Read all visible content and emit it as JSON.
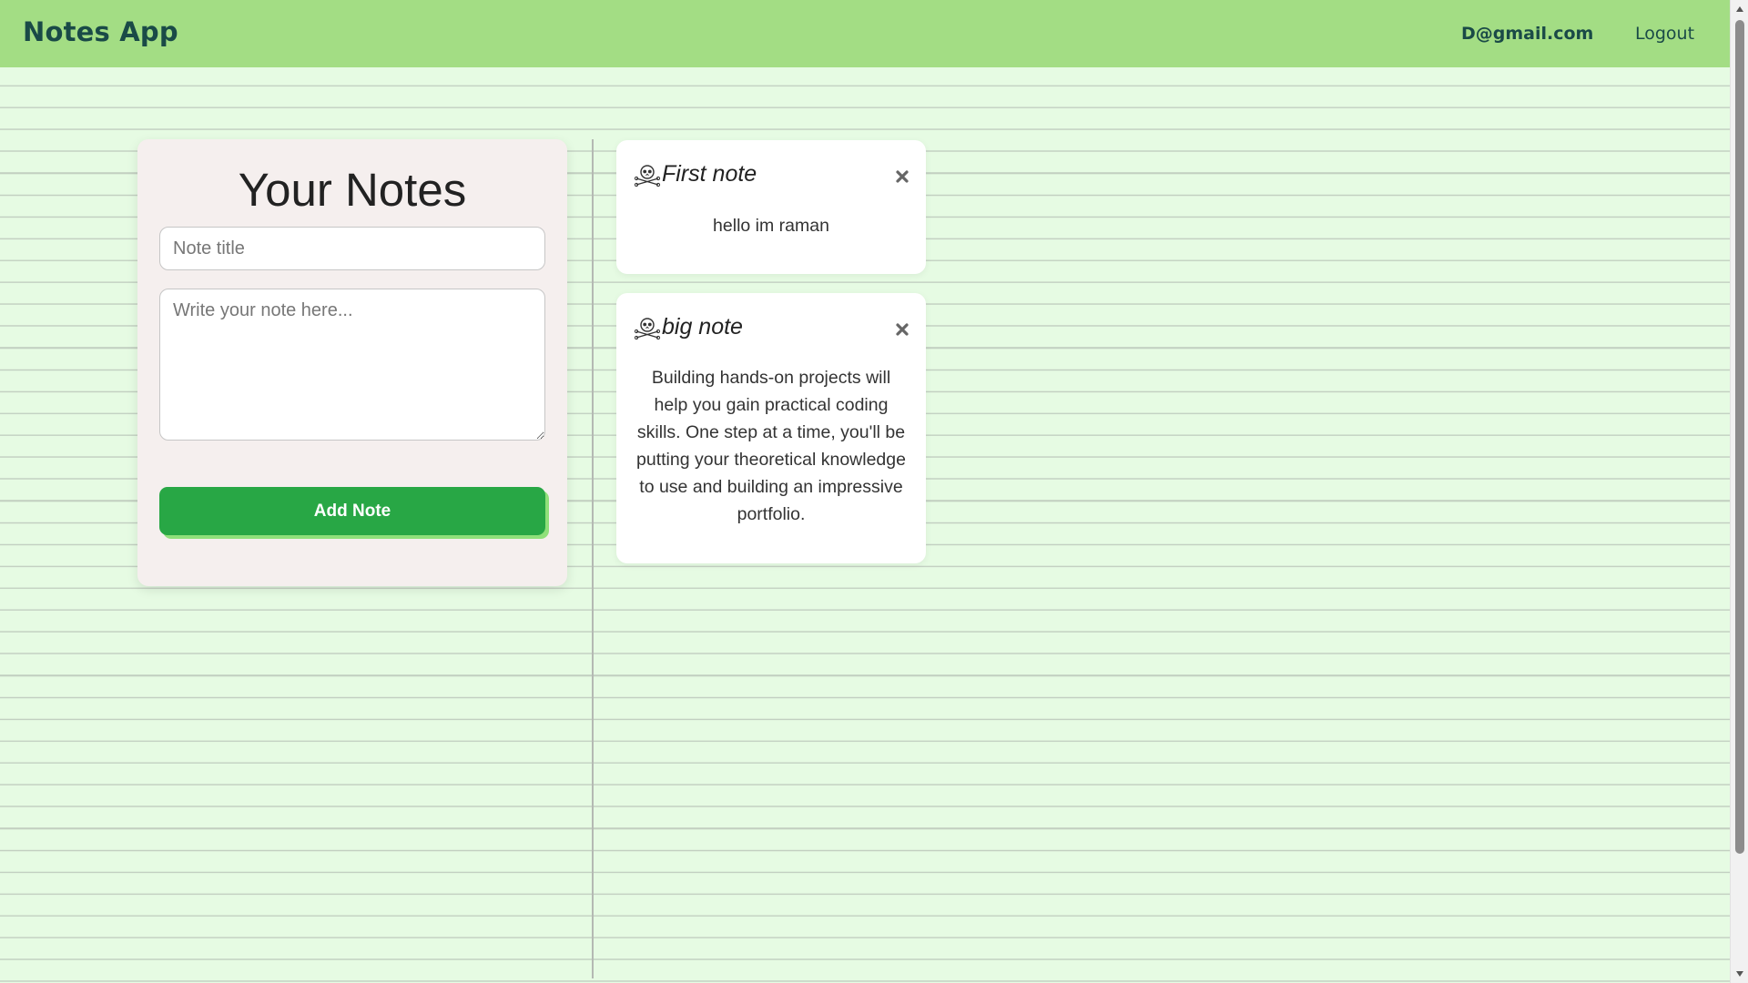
{
  "header": {
    "brand": "Notes App",
    "user_email": "D@gmail.com",
    "logout_label": "Logout",
    "background_color": "#a3dd84"
  },
  "form": {
    "title": "Your Notes",
    "title_placeholder": "Note title",
    "body_placeholder": "Write your note here...",
    "add_button_label": "Add Note",
    "button_color": "#28a745"
  },
  "notes": [
    {
      "icon": "skull-icon",
      "title": "First note",
      "body": "hello im raman"
    },
    {
      "icon": "skull-icon",
      "title": "big note",
      "body": "Building hands-on projects will help you gain practical coding skills. One step at a time, you'll be putting your theoretical knowledge to use and building an impressive portfolio."
    }
  ],
  "page": {
    "background_color": "#e6fbe3",
    "line_color": "#c2cfc1"
  }
}
